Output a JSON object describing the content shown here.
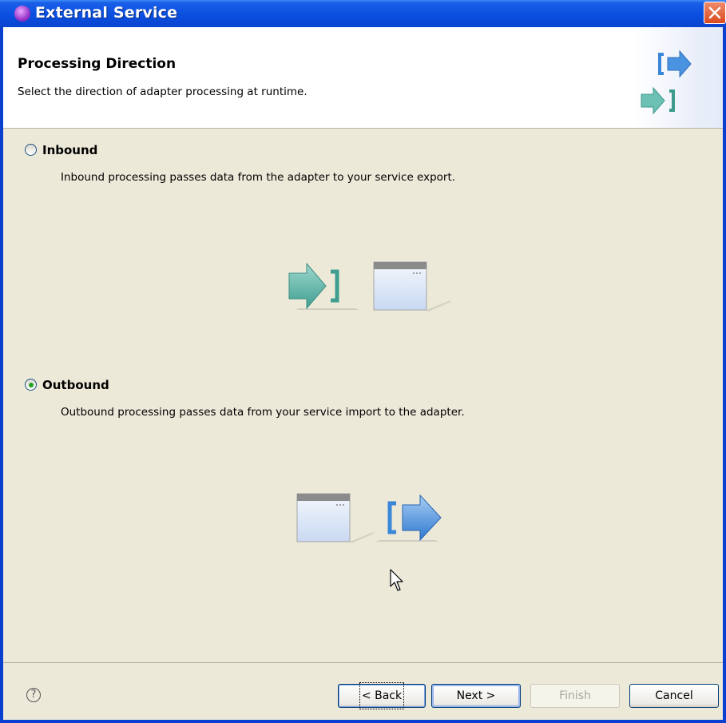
{
  "window": {
    "title": "External Service"
  },
  "banner": {
    "title": "Processing Direction",
    "description": "Select the direction of adapter processing at runtime."
  },
  "options": [
    {
      "label": "Inbound",
      "description": "Inbound processing passes data from the adapter to your service export.",
      "selected": false
    },
    {
      "label": "Outbound",
      "description": "Outbound processing passes data from your service import to the adapter.",
      "selected": true
    }
  ],
  "buttons": {
    "back": "< Back",
    "next": "Next >",
    "finish": "Finish",
    "cancel": "Cancel"
  },
  "icons": {
    "title": "service-wizard-icon",
    "help": "help-icon",
    "close": "close-icon"
  },
  "colors": {
    "titlebar": "#0b4fe0",
    "window_bg": "#ece9d8",
    "radio_selected": "#21a121",
    "arrow_blue": "#3a86d8",
    "arrow_teal": "#4fb0a4"
  }
}
